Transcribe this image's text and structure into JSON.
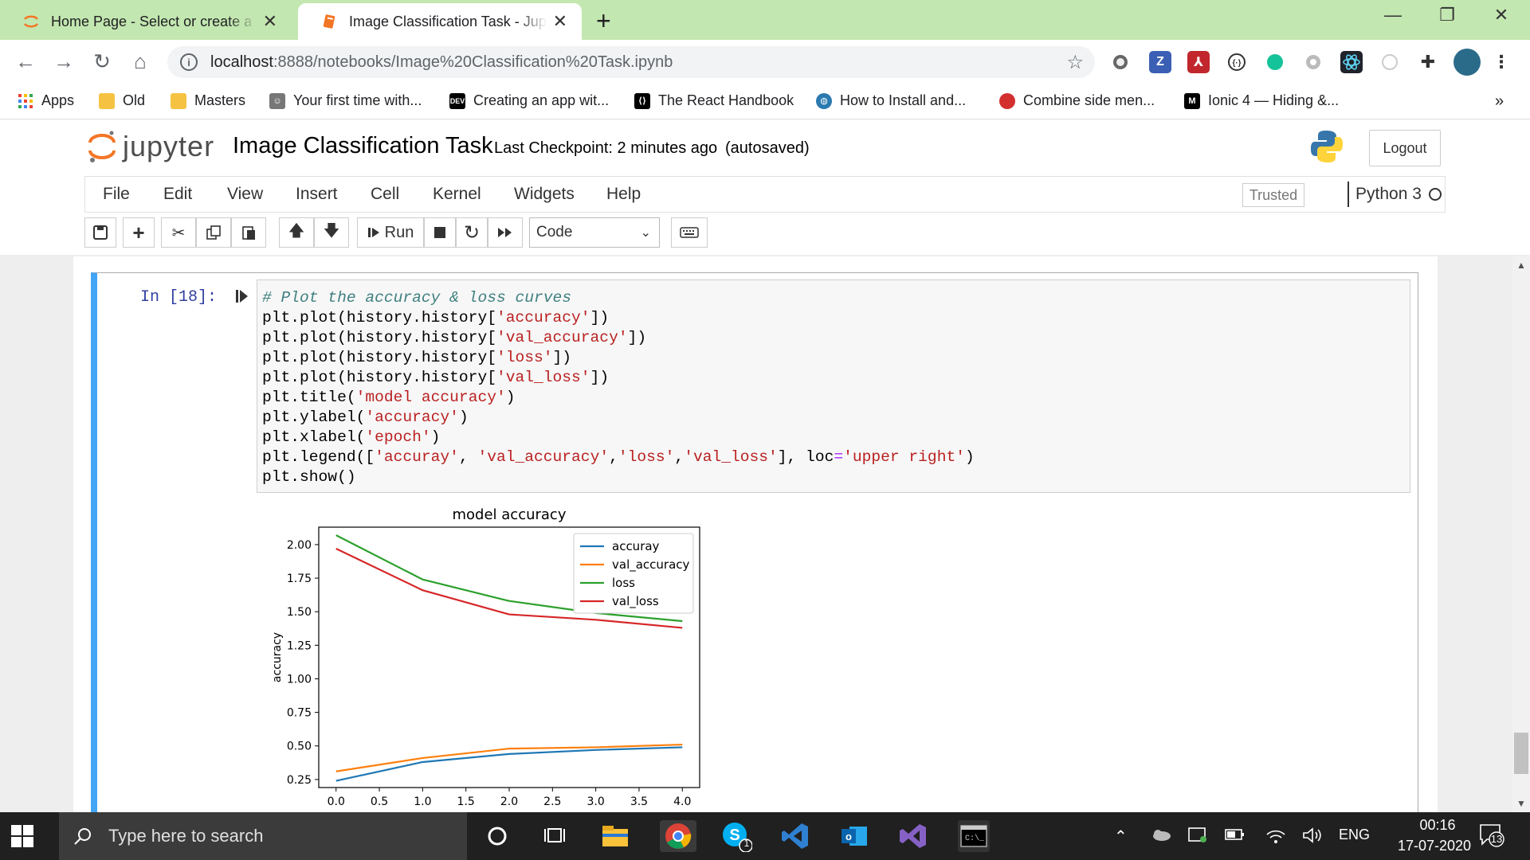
{
  "browser": {
    "tabs": [
      {
        "title": "Home Page - Select or create a notebook",
        "active": false
      },
      {
        "title": "Image Classification Task - Jupyter Notebook",
        "active": true
      }
    ],
    "url_host": "localhost",
    "url_path": ":8888/notebooks/Image%20Classification%20Task.ipynb",
    "bookmarks": [
      {
        "label": "Apps"
      },
      {
        "label": "Old"
      },
      {
        "label": "Masters"
      },
      {
        "label": "Your first time with..."
      },
      {
        "label": "Creating an app wit..."
      },
      {
        "label": "The React Handbook"
      },
      {
        "label": "How to Install and..."
      },
      {
        "label": "Combine side men..."
      },
      {
        "label": "Ionic 4 — Hiding &..."
      }
    ],
    "bookmarks_more": "»"
  },
  "jupyter": {
    "logo_text": "jupyter",
    "notebook_title": "Image Classification Task",
    "checkpoint": "Last Checkpoint: 2 minutes ago",
    "autosave": "(autosaved)",
    "logout_label": "Logout",
    "menu": [
      "File",
      "Edit",
      "View",
      "Insert",
      "Cell",
      "Kernel",
      "Widgets",
      "Help"
    ],
    "trusted_label": "Trusted",
    "kernel_name": "Python 3",
    "run_label": "Run",
    "cell_type": "Code"
  },
  "cell": {
    "prompt": "In [18]:",
    "code_lines": [
      "# Plot the accuracy & loss curves",
      "plt.plot(history.history['accuracy'])",
      "plt.plot(history.history['val_accuracy'])",
      "plt.plot(history.history['loss'])",
      "plt.plot(history.history['val_loss'])",
      "plt.title('model accuracy')",
      "plt.ylabel('accuracy')",
      "plt.xlabel('epoch')",
      "plt.legend(['accuray', 'val_accuracy','loss','val_loss'], loc='upper right')",
      "plt.show()"
    ]
  },
  "chart_data": {
    "type": "line",
    "title": "model accuracy",
    "xlabel": "",
    "ylabel": "accuracy",
    "x": [
      0,
      1,
      2,
      3,
      4
    ],
    "xlim": [
      -0.2,
      4.2
    ],
    "ylim": [
      0.19,
      2.13
    ],
    "x_ticks": [
      "0.0",
      "0.5",
      "1.0",
      "1.5",
      "2.0",
      "2.5",
      "3.0",
      "3.5",
      "4.0"
    ],
    "x_tick_values": [
      0,
      0.5,
      1,
      1.5,
      2,
      2.5,
      3,
      3.5,
      4
    ],
    "y_ticks": [
      "0.25",
      "0.50",
      "0.75",
      "1.00",
      "1.25",
      "1.50",
      "1.75",
      "2.00"
    ],
    "y_tick_values": [
      0.25,
      0.5,
      0.75,
      1.0,
      1.25,
      1.5,
      1.75,
      2.0
    ],
    "legend_position": "upper right",
    "grid": false,
    "series": [
      {
        "name": "accuray",
        "color": "#1f77b4",
        "values": [
          0.24,
          0.38,
          0.44,
          0.47,
          0.49
        ]
      },
      {
        "name": "val_accuracy",
        "color": "#ff7f0e",
        "values": [
          0.31,
          0.41,
          0.48,
          0.49,
          0.51
        ]
      },
      {
        "name": "loss",
        "color": "#2ca02c",
        "values": [
          2.07,
          1.74,
          1.58,
          1.49,
          1.43
        ]
      },
      {
        "name": "val_loss",
        "color": "#d62728",
        "values": [
          1.97,
          1.66,
          1.48,
          1.44,
          1.38
        ]
      }
    ]
  },
  "taskbar": {
    "search_placeholder": "Type here to search",
    "language": "ENG",
    "time": "00:16",
    "date": "17-07-2020",
    "notification_count": "13",
    "skype_badge": "1"
  }
}
